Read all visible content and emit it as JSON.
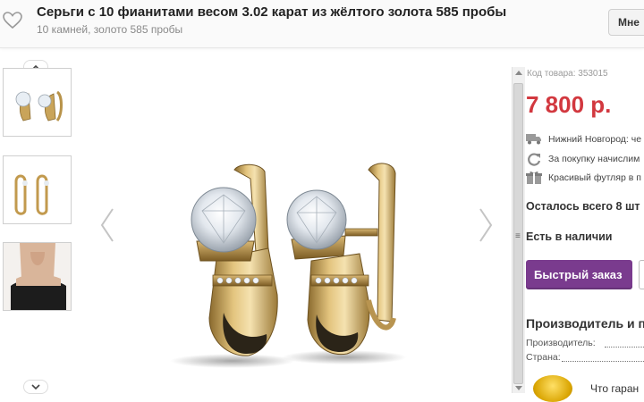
{
  "header": {
    "title": "Серьги с 10 фианитами весом 3.02 карат из жёлтого золота 585 пробы",
    "subtitle": "10 камней, золото 585 пробы",
    "more_button": "Мне"
  },
  "gallery": {
    "thumbnails": [
      "earrings-pair-front",
      "earrings-pair-side",
      "model-wearing"
    ],
    "main_image": "gold-earrings-with-cubic-zirconia"
  },
  "product": {
    "code_label": "Код товара: 353015",
    "price": "7 800 р.",
    "delivery": "Нижний Новгород: че",
    "bonus": "За покупку начислим",
    "packaging": "Красивый футляр в п",
    "stock_left": "Осталось всего 8 шт",
    "availability": "Есть в наличии",
    "quick_order": "Быстрый заказ",
    "maker_title": "Производитель и п",
    "maker_label": "Производитель:",
    "country_label": "Страна:",
    "guarantee": "Что гаран"
  },
  "colors": {
    "price": "#d2383f",
    "accent": "#7a3b8e"
  }
}
